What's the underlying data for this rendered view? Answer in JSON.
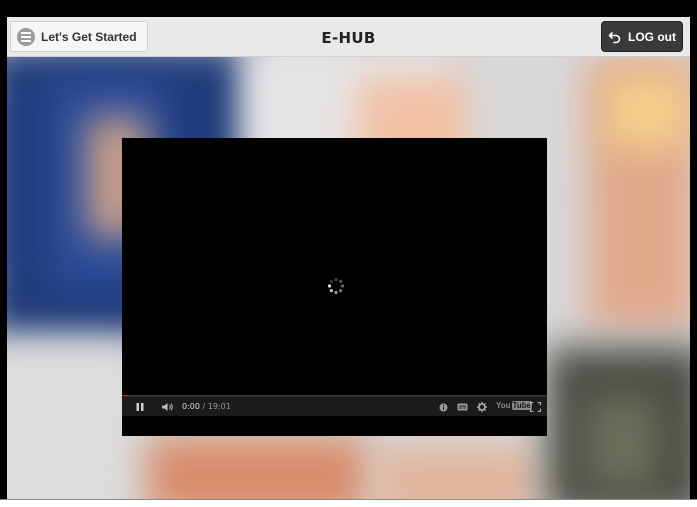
{
  "header": {
    "menu_label": "Let's Get Started",
    "title": "E-HUB",
    "logout_label": "LOG out"
  },
  "player": {
    "current_time": "0:00",
    "duration": "/ 19:01",
    "progress_fraction": 0.0,
    "logo_text": "You",
    "logo_tube": "Tube"
  },
  "icons": {
    "menu": "hamburger-circle-icon",
    "logout": "undo-arrow-icon",
    "pause": "pause-icon",
    "volume": "volume-icon",
    "info": "info-icon",
    "captions": "captions-icon",
    "settings": "gear-icon",
    "fullscreen": "fullscreen-icon",
    "loading": "loading-spinner-icon"
  },
  "colors": {
    "logout_bg": "#3a3a3a",
    "progress_red": "#cc181e"
  }
}
